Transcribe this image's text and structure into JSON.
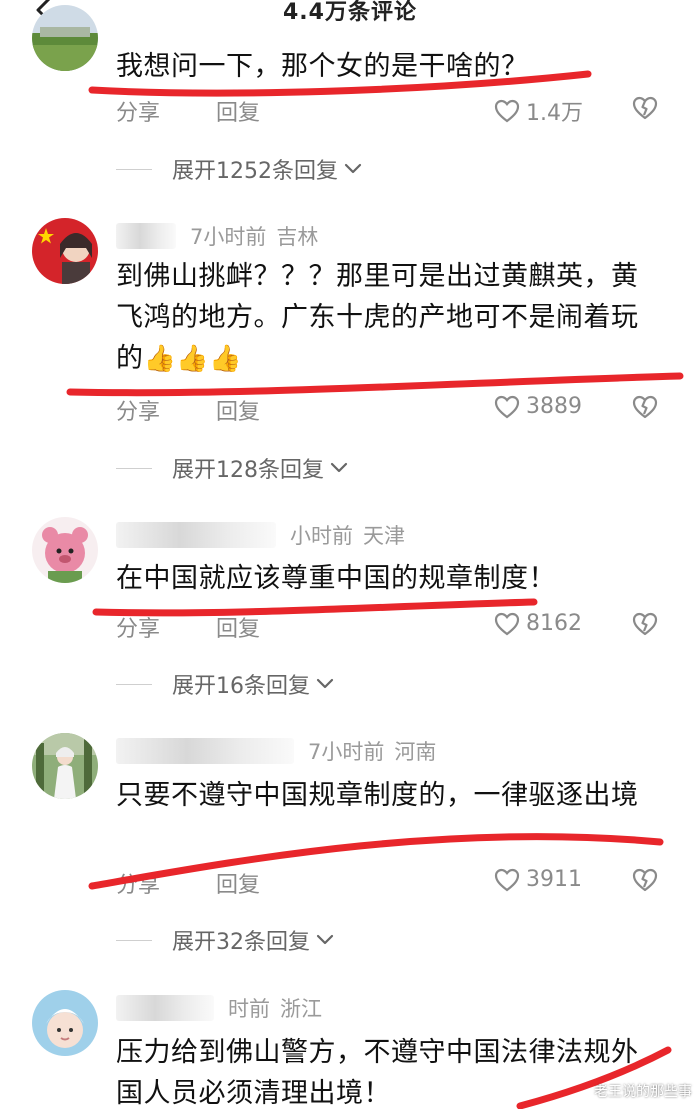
{
  "header": {
    "title": "4.4万条评论"
  },
  "actions": {
    "share_label": "分享",
    "reply_label": "回复"
  },
  "comments": [
    {
      "username": "",
      "time": "",
      "location": "",
      "text": "我想问一下，那个女的是干啥的？",
      "likes": "1.4万",
      "expand": "展开1252条回复"
    },
    {
      "username": "",
      "time": "7小时前",
      "location": "吉林",
      "text": "到佛山挑衅？？？那里可是出过黄麒英，黄飞鸿的地方。广东十虎的产地可不是闹着玩的",
      "emoji": "👍👍👍",
      "likes": "3889",
      "expand": "展开128条回复"
    },
    {
      "username": "",
      "time": "小时前",
      "location": "天津",
      "text": "在中国就应该尊重中国的规章制度！",
      "likes": "8162",
      "expand": "展开16条回复"
    },
    {
      "username": "",
      "time": "7小时前",
      "location": "河南",
      "text": "只要不遵守中国规章制度的，一律驱逐出境",
      "likes": "3911",
      "expand": "展开32条回复"
    },
    {
      "username": "",
      "time": "时前",
      "location": "浙江",
      "text": "压力给到佛山警方，不遵守中国法律法规外国人员必须清理出境！"
    }
  ],
  "watermark": "老王说的那些事",
  "colors": {
    "underline": "#e8262b",
    "meta": "#9a9a9a",
    "action": "#8a8a8a"
  }
}
